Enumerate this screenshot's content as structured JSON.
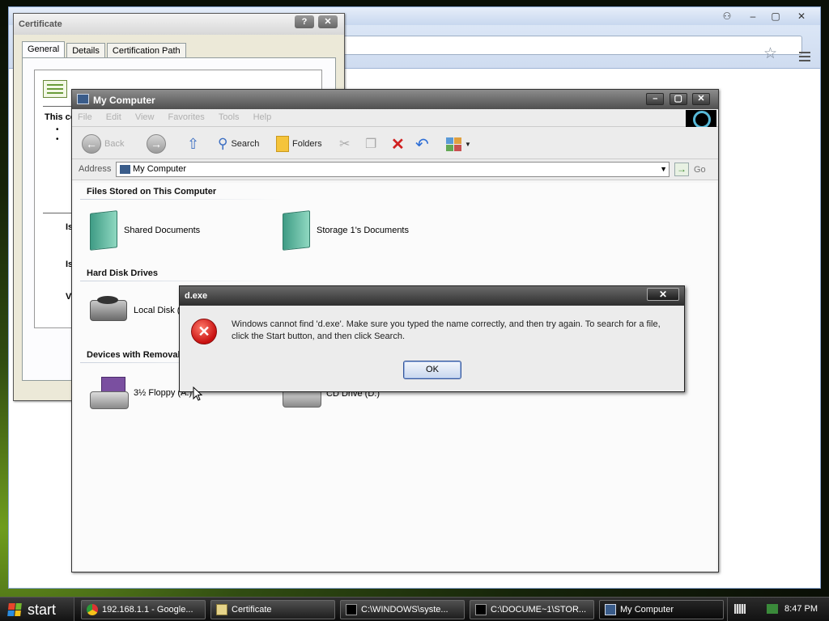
{
  "browser": {
    "controls": {
      "user": "⚇",
      "minimize": "–",
      "maximize": "▢",
      "close": "✕"
    },
    "star_icon": "star-icon",
    "menu_icon": "wrench-icon"
  },
  "cert": {
    "title": "Certificate",
    "tabs": [
      "General",
      "Details",
      "Certification Path"
    ],
    "active_tab": "General",
    "partial": {
      "this_ce": "This ce",
      "is1": "Is",
      "is2": "Is",
      "v": "V"
    }
  },
  "mycomputer": {
    "title": "My Computer",
    "menu": [
      "File",
      "Edit",
      "View",
      "Favorites",
      "Tools",
      "Help"
    ],
    "toolbar": {
      "back": "Back",
      "search": "Search",
      "folders": "Folders"
    },
    "address": {
      "label": "Address",
      "value": "My Computer",
      "go": "Go"
    },
    "groups": {
      "files": "Files Stored on This Computer",
      "hdd": "Hard Disk Drives",
      "removable": "Devices with Removal"
    },
    "items": {
      "shared": "Shared Documents",
      "storage": "Storage 1's Documents",
      "local_disk": "Local Disk (C",
      "floppy": "3½ Floppy (A:)",
      "cd": "CD Drive (D:)"
    }
  },
  "dialog": {
    "title": "d.exe",
    "message": "Windows cannot find 'd.exe'. Make sure you typed the name correctly, and then try again. To search for a file, click the Start button, and then click Search.",
    "ok": "OK",
    "close": "✕"
  },
  "taskbar": {
    "start": "start",
    "tasks": [
      {
        "label": "192.168.1.1 - Google..."
      },
      {
        "label": "Certificate"
      },
      {
        "label": "C:\\WINDOWS\\syste..."
      },
      {
        "label": "C:\\DOCUME~1\\STOR..."
      },
      {
        "label": "My Computer"
      }
    ],
    "clock": "8:47 PM"
  },
  "colors": {
    "error_red": "#c81010",
    "ok_border": "#33559a",
    "desktop_green": "#6f9d1e"
  }
}
